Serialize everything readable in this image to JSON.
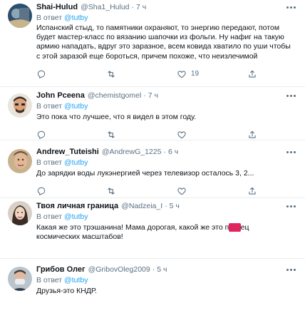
{
  "colors": {
    "accent": "#1da1f2",
    "muted": "#5b7083",
    "text": "#0f1419",
    "divider": "#ebeef0",
    "censor": "#e0245e"
  },
  "icons": {
    "reply": "reply-icon",
    "retweet": "retweet-icon",
    "like": "heart-icon",
    "share": "share-icon",
    "more": "more-icon"
  },
  "tweets": [
    {
      "name": "Shai-Hulud",
      "handle": "@Sha1_Hulud",
      "dot": "·",
      "time": "7 ч",
      "reply_prefix": "В ответ",
      "reply_to": "@tutby",
      "lines": [
        "Испанский стыд, то памятники охраняют, то энергию передают, потом",
        "будет мастер-класс по вязанию шапочки из фольги. Ну нафиг на такую",
        "армию нападать, вдруг это заразное, всем ковида хватило по уши чтобы",
        "с этой заразой еще бороться, причем похоже, что неизлечимой"
      ],
      "likes": "19"
    },
    {
      "name": "John Pceena",
      "handle": "@chemistgomel",
      "dot": "·",
      "time": "7 ч",
      "reply_prefix": "В ответ",
      "reply_to": "@tutby",
      "lines": [
        "Это пока что лучшее, что я видел в этом году."
      ],
      "likes": ""
    },
    {
      "name": "Andrew_Tuteishi",
      "handle": "@AndrewG_1225",
      "dot": "·",
      "time": "6 ч",
      "reply_prefix": "В ответ",
      "reply_to": "@tutby",
      "lines": [
        "До зарядки воды лукэнергией через телевизор осталось 3, 2..."
      ],
      "likes": ""
    },
    {
      "name": "Твоя личная граница",
      "handle": "@Nadzeia_I",
      "dot": "·",
      "time": "5 ч",
      "reply_prefix": "В ответ",
      "reply_to": "@tutby",
      "line1_before": "Какая же это трэшанина! Мама дорогая, какой же это п",
      "line1_censor": "****",
      "line1_after": "ец",
      "line2": "космических масштабов!",
      "likes": ""
    },
    {
      "name": "Грибов Олег",
      "handle": "@GribovOleg2009",
      "dot": "·",
      "time": "5 ч",
      "reply_prefix": "В ответ",
      "reply_to": "@tutby",
      "lines": [
        "Друзья-это КНДР."
      ],
      "likes": ""
    }
  ]
}
